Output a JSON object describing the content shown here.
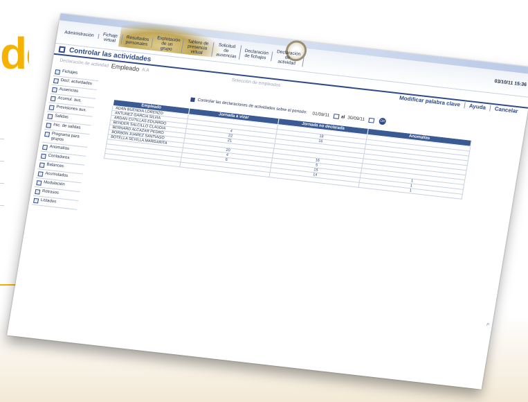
{
  "brochure": {
    "side_word": "de"
  },
  "header": {
    "datetime": "03/10/11 15:36",
    "menu": [
      {
        "label": "Administración"
      },
      {
        "label": "Fichaje virtual"
      },
      {
        "label": "Resultados personales"
      },
      {
        "label": "Explotación de un grupo"
      },
      {
        "label": "Tablero de presencia virtual"
      },
      {
        "label": "Solicitud de ausencias"
      },
      {
        "label": "Declaración de fichajes"
      },
      {
        "label": "Declaración de actividad"
      }
    ]
  },
  "page": {
    "title": "Controlar las actividades",
    "breadcrumb_prefix": "Declaración de actividad",
    "breadcrumb_current": "Empleado",
    "breadcrumb_suffix": "A.A",
    "hint": "Selección de empleados"
  },
  "actions": {
    "change_password": "Modificar palabra clave",
    "help": "Ayuda",
    "cancel": "Cancelar"
  },
  "sidebar": {
    "items": [
      {
        "label": "Fichajes"
      },
      {
        "label": "Decl. actividades"
      },
      {
        "label": "Ausencias"
      },
      {
        "label": "Acumul. aus."
      },
      {
        "label": "Previsiones aus."
      },
      {
        "label": "Salidas"
      },
      {
        "label": "Inic. de salidas"
      },
      {
        "label": "Programa para grupos"
      },
      {
        "label": "Anomalías"
      },
      {
        "label": "Contadores"
      },
      {
        "label": "Balances"
      },
      {
        "label": "Acumulados"
      },
      {
        "label": "Modulación"
      },
      {
        "label": "Retrasos"
      },
      {
        "label": "Listados"
      }
    ]
  },
  "filter": {
    "label": "Controlar las declaraciones de actividades sobre el periodo:",
    "date_from": "01/09/11",
    "to_label": "al",
    "date_to": "30/09/11",
    "ok": "OK"
  },
  "table": {
    "headers": [
      "Empleado",
      "Jornada a vizar",
      "Jornada no declarada",
      "Anomalías"
    ],
    "rows": [
      {
        "name": "ADAN BUENDIA LORENZO",
        "a": "",
        "b": "",
        "c": ""
      },
      {
        "name": "ANTUNEZ GARCIA SILVIA",
        "a": "",
        "b": "18",
        "c": ""
      },
      {
        "name": "ARDAN CUTILLAS EDUARDO",
        "a": "4",
        "b": "16",
        "c": ""
      },
      {
        "name": "BENDER SALCILLO CLAUDIA",
        "a": "22",
        "b": "",
        "c": ""
      },
      {
        "name": "BERNARD ALCAZAR PEDRO",
        "a": "21",
        "b": "",
        "c": ""
      },
      {
        "name": "BORBON JUAREZ SANTIAGO",
        "a": "",
        "b": "",
        "c": ""
      },
      {
        "name": "BOTELLA SEVILLA MARGARITA",
        "a": "20",
        "b": "16",
        "c": ""
      },
      {
        "name": "",
        "a": "4",
        "b": "5",
        "c": ""
      },
      {
        "name": "",
        "a": "6",
        "b": "15",
        "c": "1"
      },
      {
        "name": "",
        "a": "",
        "b": "14",
        "c": "1"
      },
      {
        "name": "",
        "a": "",
        "b": "",
        "c": "1"
      }
    ]
  },
  "colors": {
    "accent": "#2f4a86",
    "table_header": "#3a5a94",
    "brochure_yellow": "#f5b300"
  }
}
